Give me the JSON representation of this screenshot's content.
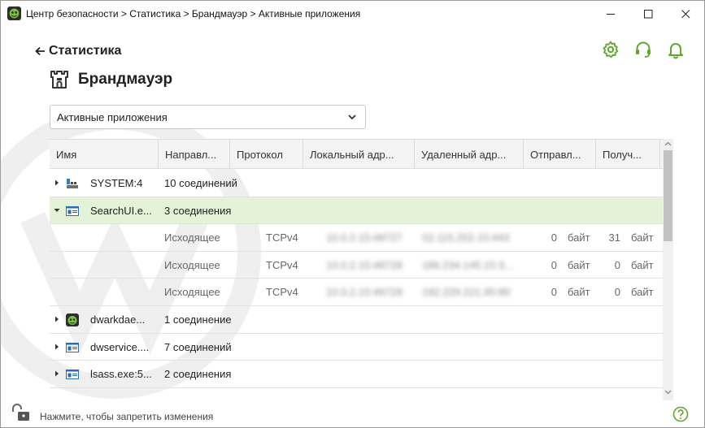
{
  "window": {
    "title": "Центр безопасности > Статистика > Брандмауэр > Активные приложения"
  },
  "header": {
    "back_label": "Статистика",
    "page_title": "Брандмауэр"
  },
  "filter": {
    "selected": "Активные приложения"
  },
  "table": {
    "columns": [
      "Имя",
      "Направл...",
      "Протокол",
      "Локальный адр...",
      "Удаленный адр...",
      "Отправл...",
      "Получ..."
    ],
    "rows": [
      {
        "name": "SYSTEM:4",
        "summary": "10 соединений",
        "icon": "system-server-icon",
        "expanded": false
      },
      {
        "name": "SearchUI.e...",
        "summary": "3 соединения",
        "icon": "application-window-icon",
        "expanded": true
      },
      {
        "direction": "Исходящее",
        "protocol": "TCPv4",
        "local": "10.0.2.15:49727",
        "remote": "52.115.252.15:443",
        "sent_value": "0",
        "sent_unit": "байт",
        "recv_value": "31",
        "recv_unit": "байт"
      },
      {
        "direction": "Исходящее",
        "protocol": "TCPv4",
        "local": "10.0.2.15:49728",
        "remote": "186.234.145.15:3...",
        "sent_value": "0",
        "sent_unit": "байт",
        "recv_value": "0",
        "recv_unit": "байт"
      },
      {
        "direction": "Исходящее",
        "protocol": "TCPv4",
        "local": "10.0.2.15:49729",
        "remote": "192.229.221.95:80",
        "sent_value": "0",
        "sent_unit": "байт",
        "recv_value": "0",
        "recv_unit": "байт"
      },
      {
        "name": "dwarkdae...",
        "summary": "1 соединение",
        "icon": "drweb-spider-icon",
        "expanded": false
      },
      {
        "name": "dwservice....",
        "summary": "7 соединений",
        "icon": "application-window-icon",
        "expanded": false
      },
      {
        "name": "lsass.exe:5...",
        "summary": "2 соединения",
        "icon": "application-window-icon",
        "expanded": false
      }
    ]
  },
  "footer": {
    "lock_text": "Нажмите, чтобы запретить изменения"
  },
  "colors": {
    "accent": "#5fa82c",
    "selected_row": "#e4f2d8"
  }
}
